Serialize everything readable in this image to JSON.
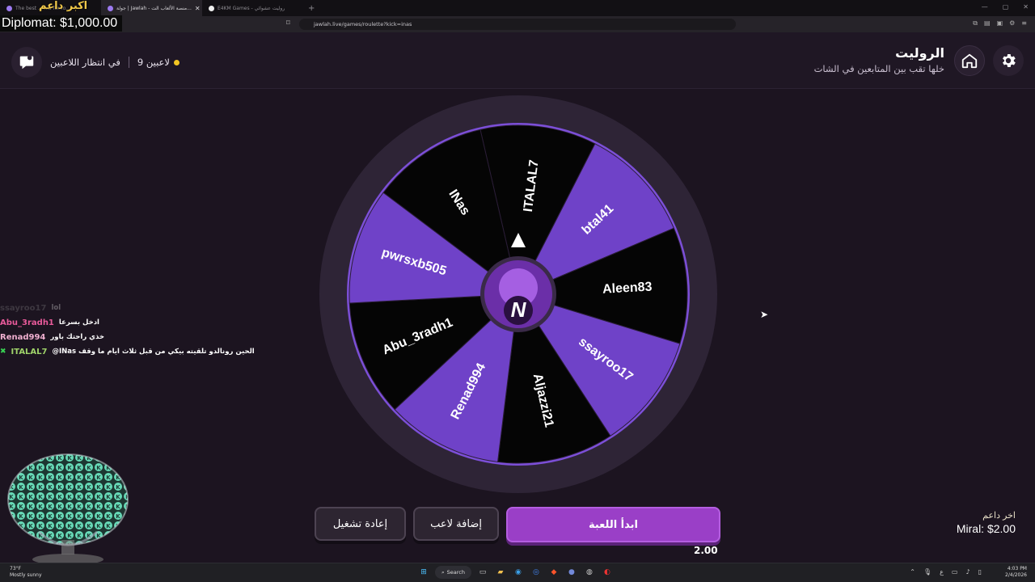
{
  "browser": {
    "tabs": [
      {
        "label": "The best ... ...s for fo...",
        "active": false
      },
      {
        "label": "جولة | Jawlah - منصة الألعاب الت...",
        "active": true
      },
      {
        "label": "E4KM Games - روليت عشوائي",
        "active": false
      }
    ],
    "url": "jawlah.live/games/roulette?kick=inas"
  },
  "overlay": {
    "top_donor": "اكبر داعم",
    "diplomat": "Diplomat: $1,000.00",
    "last_donor_label": "اخر داعم",
    "last_donor_value": "Miral: $2.00"
  },
  "header": {
    "title": "الروليت",
    "subtitle": "خلها تقب بين المتابعين في الشات",
    "waiting": "في انتظار اللاعبين",
    "player_count": "9 لاعبين"
  },
  "wheel": {
    "players": [
      "ITALAL7",
      "btal41",
      "Aleen83",
      "ssayroo17",
      "Aljazzi21",
      "Renad994",
      "Abu_3radh1",
      "pwrsxb505",
      "INas"
    ],
    "colors": {
      "purple": "#6f42c8",
      "black": "#050505",
      "rim": "#2e2436",
      "border": "#7c4fd8"
    }
  },
  "chat": [
    {
      "user": "ssayroo17",
      "message": "lol",
      "color": "#8a8a8a",
      "faded": true,
      "badge": false
    },
    {
      "user": "Abu_3radh1",
      "message": "ادخل بسرعا",
      "color": "#e85a9a",
      "faded": false,
      "badge": false
    },
    {
      "user": "Renad994",
      "message": "خذي راحتك باور",
      "color": "#f0b0d0",
      "faded": false,
      "badge": false
    },
    {
      "user": "ITALAL7",
      "message": "@INas الحين رونالدو تلقيته بيكي من قبل ثلاث ايام ما وقف",
      "color": "#9fd36a",
      "faded": false,
      "badge": true
    }
  ],
  "controls": {
    "restart": "إعادة تشغيل",
    "add_player": "إضافة لاعب",
    "start": "ابدأ اللعبة",
    "speed": "2.00"
  },
  "taskbar": {
    "weather_temp": "73°F",
    "weather_desc": "Mostly sunny",
    "search": "Search",
    "time": "4:03 PM",
    "date": "2/4/2026",
    "lang": "ع"
  }
}
